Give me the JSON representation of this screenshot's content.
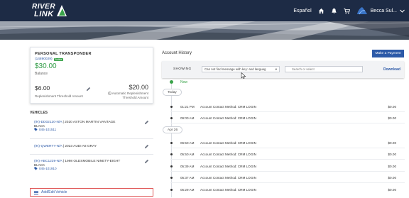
{
  "brand": {
    "line1": "RIVER",
    "line2": "LINK"
  },
  "nav": {
    "language": "Español",
    "user_name": "Becca Sul..."
  },
  "account_card": {
    "type": "PERSONAL TRANSPONDER",
    "account_id": "(14890029)",
    "badge": "Active",
    "balance": "$30.00",
    "balance_label": "Balance",
    "threshold_amount": "$6.00",
    "threshold_label": "Replenishment Threshold Amount",
    "auto_amount": "$20.00",
    "auto_label_1": "Automatic Replenishment",
    "auto_label_2": "Threshold Amount"
  },
  "vehicles": {
    "title": "VEHICLES",
    "items": [
      {
        "plate": "(IN)-DD02120-N/A",
        "desc": "2020 ASTON MARTIN VANTAGE",
        "color": "BLACK",
        "tag": "045-101511"
      },
      {
        "plate": "(IN)-QWERTY-N/A",
        "desc": "2023 AUDI A8 GRAY",
        "color": "",
        "tag": ""
      },
      {
        "plate": "(IN)-ABC1239-N/A",
        "desc": "1998 OLDSMOBILE NINETY-EIGHT",
        "color": "BLACK",
        "tag": "045-101910"
      }
    ],
    "add_label": "Add/Edit Vehicle"
  },
  "history": {
    "title": "Account History",
    "payment_button": "Make a Payment",
    "showing_label": "SHOWING",
    "filter_value": "Can not find message with key: and languag",
    "search_placeholder": "Search or select",
    "download_label": "Download",
    "now_label": "Now",
    "groups": [
      {
        "label": "Today",
        "rows": [
          {
            "time": "01:21 PM",
            "desc": "Account Contact Method: CRM LOGIN",
            "amount": "$0.00"
          },
          {
            "time": "09:00 AM",
            "desc": "Account Contact Method: CRM LOGIN",
            "amount": "$0.00"
          }
        ]
      },
      {
        "label": "Apr 26",
        "rows": [
          {
            "time": "06:50 AM",
            "desc": "Account Contact Method: CRM LOGIN",
            "amount": "$0.00"
          },
          {
            "time": "05:50 AM",
            "desc": "Account Contact Method: CRM LOGIN",
            "amount": "$0.00"
          },
          {
            "time": "05:39 AM",
            "desc": "Account Contact Method: CRM LOGIN",
            "amount": "$0.00"
          },
          {
            "time": "05:37 AM",
            "desc": "Account Contact Method: CRM LOGIN",
            "amount": "$0.00"
          },
          {
            "time": "05:29 AM",
            "desc": "Account Contact Method: CRM LOGIN",
            "amount": "$0.00"
          }
        ]
      }
    ]
  },
  "colors": {
    "nav_bg": "#1d2b45",
    "accent": "#2d5aa8",
    "positive": "#2f9b44",
    "highlight": "#e05a5a"
  }
}
